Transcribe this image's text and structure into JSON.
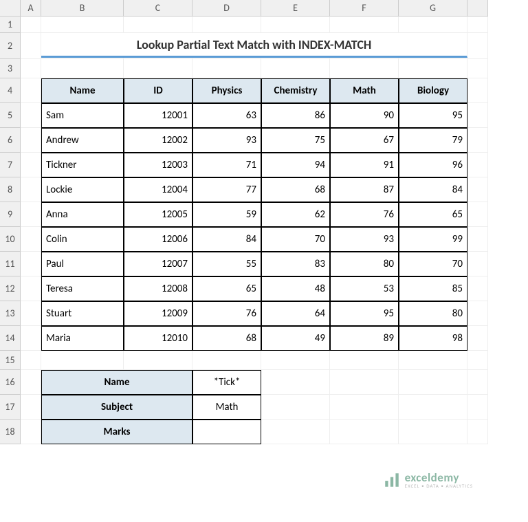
{
  "columns": [
    "A",
    "B",
    "C",
    "D",
    "E",
    "F",
    "G"
  ],
  "rows": [
    "1",
    "2",
    "3",
    "4",
    "5",
    "6",
    "7",
    "8",
    "9",
    "10",
    "11",
    "12",
    "13",
    "14",
    "15",
    "16",
    "17",
    "18"
  ],
  "title": "Lookup Partial Text Match with INDEX-MATCH",
  "table": {
    "headers": [
      "Name",
      "ID",
      "Physics",
      "Chemistry",
      "Math",
      "Biology"
    ],
    "data": [
      [
        "Sam",
        "12001",
        "63",
        "86",
        "90",
        "95"
      ],
      [
        "Andrew",
        "12002",
        "93",
        "75",
        "67",
        "79"
      ],
      [
        "Tickner",
        "12003",
        "71",
        "94",
        "91",
        "96"
      ],
      [
        "Lockie",
        "12004",
        "77",
        "68",
        "87",
        "84"
      ],
      [
        "Anna",
        "12005",
        "59",
        "62",
        "76",
        "65"
      ],
      [
        "Colin",
        "12006",
        "84",
        "70",
        "93",
        "99"
      ],
      [
        "Paul",
        "12007",
        "55",
        "83",
        "80",
        "70"
      ],
      [
        "Teresa",
        "12008",
        "65",
        "48",
        "53",
        "85"
      ],
      [
        "Stuart",
        "12009",
        "76",
        "64",
        "95",
        "80"
      ],
      [
        "Maria",
        "12010",
        "68",
        "49",
        "89",
        "98"
      ]
    ]
  },
  "lookup": {
    "name_label": "Name",
    "name_value": "*Tick*",
    "subject_label": "Subject",
    "subject_value": "Math",
    "marks_label": "Marks",
    "marks_value": ""
  },
  "watermark": {
    "main": "exceldemy",
    "sub": "EXCEL • DATA • ANALYTICS"
  }
}
